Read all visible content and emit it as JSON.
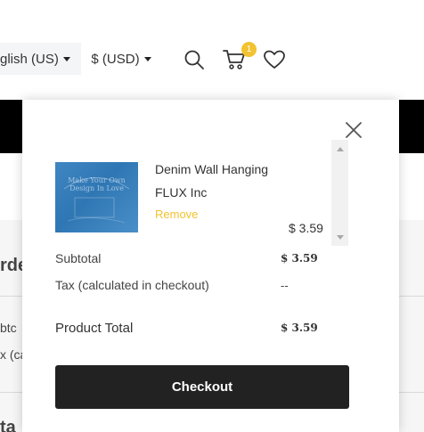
{
  "header": {
    "language": "glish (US)",
    "currency": "$ (USD)",
    "cart_count": "1",
    "icons": [
      "search-icon",
      "cart-icon",
      "heart-icon"
    ]
  },
  "background_page": {
    "order_heading": "rde",
    "subtotal_fragment": "btc",
    "tax_fragment": "x (ca",
    "total_fragment": "ta"
  },
  "minicart": {
    "item": {
      "name": "Denim Wall Hanging",
      "vendor": "FLUX Inc",
      "remove_label": "Remove",
      "price": "$ 3.59",
      "image_caption": "Make Your Own Design In Love"
    },
    "subtotal_label": "Subtotal",
    "subtotal_value": "$ 3.59",
    "tax_label": "Tax (calculated in checkout)",
    "tax_value": "--",
    "total_label": "Product Total",
    "total_value": "$ 3.59",
    "checkout_label": "Checkout"
  },
  "colors": {
    "accent": "#f2c230",
    "button": "#222222",
    "black_band": "#000000"
  }
}
